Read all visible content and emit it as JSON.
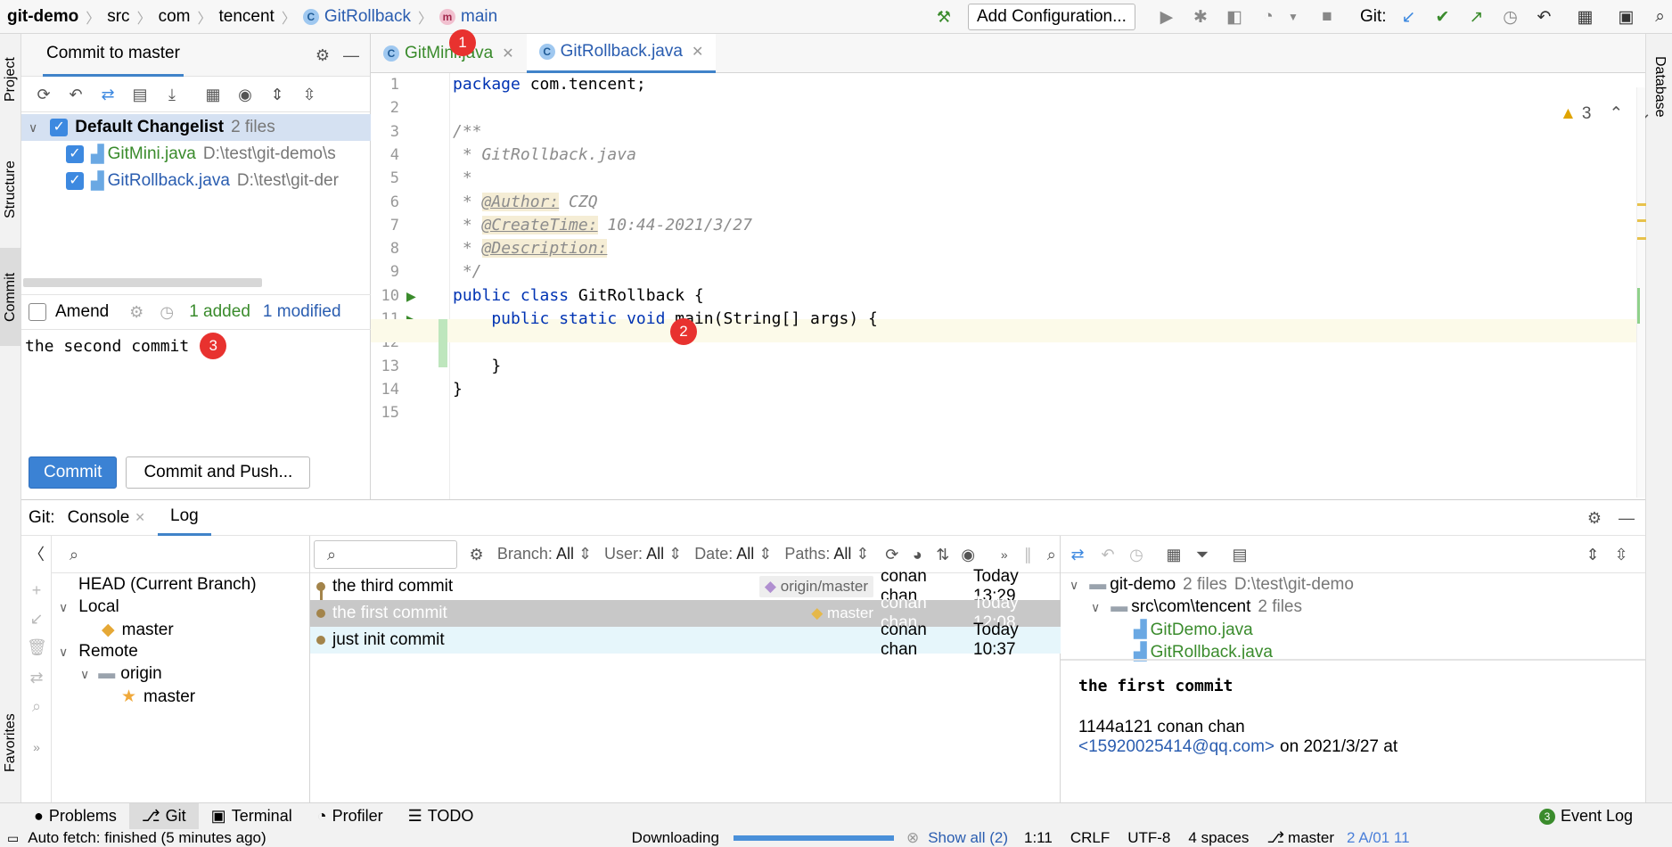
{
  "breadcrumb": {
    "project": "git-demo",
    "parts": [
      "src",
      "com",
      "tencent"
    ],
    "class": "GitRollback",
    "method": "main"
  },
  "toolbar": {
    "add_configuration": "Add Configuration...",
    "git_label": "Git:"
  },
  "side_tabs": {
    "project": "Project",
    "structure": "Structure",
    "commit": "Commit",
    "favorites": "Favorites",
    "database": "Database"
  },
  "commit_panel": {
    "title": "Commit to master",
    "changelist": {
      "name": "Default Changelist",
      "count": "2 files",
      "files": [
        {
          "name": "GitMini.java",
          "path": "D:\\test\\git-demo\\s"
        },
        {
          "name": "GitRollback.java",
          "path": "D:\\test\\git-der"
        }
      ]
    },
    "amend_label": "Amend",
    "added": "1 added",
    "modified": "1 modified",
    "message": "the second commit",
    "commit_button": "Commit",
    "commit_push_button": "Commit and Push..."
  },
  "badges": {
    "one": "1",
    "two": "2",
    "three": "3"
  },
  "editor": {
    "tabs": [
      {
        "label": "GitMini.java",
        "active": false
      },
      {
        "label": "GitRollback.java",
        "active": true
      }
    ],
    "warnings": "3",
    "line_numbers": [
      "1",
      "2",
      "3",
      "4",
      "5",
      "6",
      "7",
      "8",
      "9",
      "10",
      "11",
      "12",
      "13",
      "14",
      "15"
    ],
    "lines": {
      "l1_kw": "package",
      "l1_rest": " com.tencent;",
      "l3": "/**",
      "l4": " * GitRollback.java",
      "l5": " *",
      "l6_pre": " * ",
      "l6_tag": "@Author:",
      "l6_val": " CZQ",
      "l7_pre": " * ",
      "l7_tag": "@CreateTime:",
      "l7_val": " 10:44-2021/3/27",
      "l8_pre": " * ",
      "l8_tag": "@Description:",
      "l9": " */",
      "l10_kw": "public class",
      "l10_rest": " GitRollback {",
      "l11_kw": "    public static void",
      "l11_rest": " main(String[] args) {",
      "l13": "    }",
      "l14": "}"
    }
  },
  "git_window": {
    "label": "Git:",
    "tabs": [
      "Console",
      "Log"
    ],
    "branches": {
      "head": "HEAD (Current Branch)",
      "local": "Local",
      "local_master": "master",
      "remote": "Remote",
      "origin": "origin",
      "origin_master": "master"
    },
    "filters": {
      "branch": "Branch:",
      "branch_val": "All",
      "user": "User:",
      "user_val": "All",
      "date": "Date:",
      "date_val": "All",
      "paths": "Paths:",
      "paths_val": "All"
    },
    "commits": [
      {
        "message": "the third commit",
        "ref": "origin/master",
        "author": "conan chan",
        "date": "Today 13:29"
      },
      {
        "message": "the first commit",
        "ref": "master",
        "author": "conan chan",
        "date": "Today 12:08"
      },
      {
        "message": "just init commit",
        "ref": "",
        "author": "conan chan",
        "date": "Today 10:37"
      }
    ],
    "details": {
      "root": "git-demo",
      "root_count": "2 files",
      "root_path": "D:\\test\\git-demo",
      "folder": "src\\com\\tencent",
      "folder_count": "2 files",
      "files": [
        "GitDemo.java",
        "GitRollback.java"
      ],
      "commit_title": "the first commit",
      "hash_author": "1144a121 conan chan",
      "email": "<15920025414@qq.com>",
      "date_text": "on 2021/3/27 at"
    }
  },
  "tool_tabs": [
    "Problems",
    "Git",
    "Terminal",
    "Profiler",
    "TODO"
  ],
  "event_log": {
    "count": "3",
    "label": "Event Log"
  },
  "status": {
    "left": "Auto fetch: finished (5 minutes ago)",
    "downloading": "Downloading",
    "show_all": "Show all (2)",
    "position": "1:11",
    "line_sep": "CRLF",
    "encoding": "UTF-8",
    "indent": "4 spaces",
    "branch": "master",
    "extra": "2 A/01 11"
  },
  "colors": {
    "accent": "#3b82d4",
    "badge": "#e8322f",
    "green": "#3a8b2c",
    "blue_link": "#2a5db0"
  }
}
